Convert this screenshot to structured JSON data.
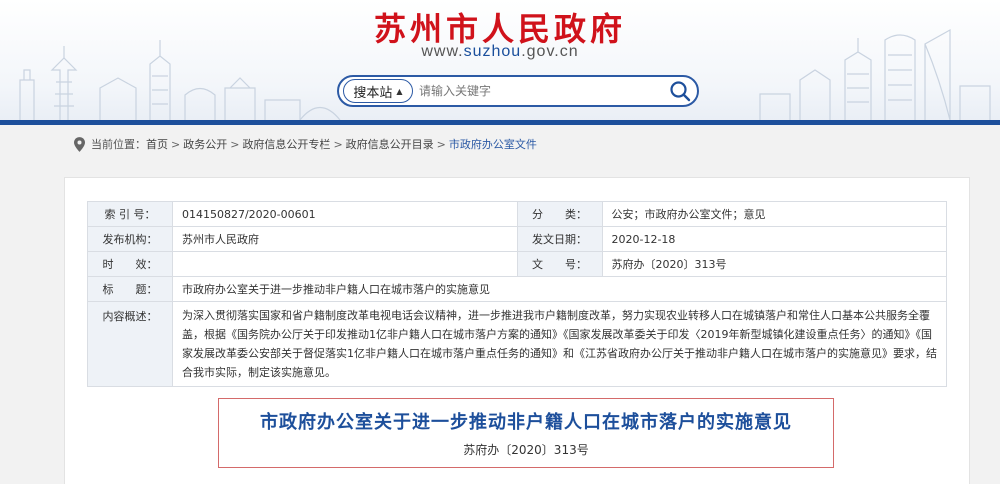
{
  "header": {
    "site_title": "苏州市人民政府",
    "site_url_prefix": "www.",
    "site_url_highlight": "suzhou",
    "site_url_suffix": ".gov.cn",
    "search_scope": "搜本站",
    "search_placeholder": "请输入关键字",
    "accent": "#d0121b",
    "brand": "#1d4f9b"
  },
  "breadcrumb": {
    "label": "当前位置：",
    "items": [
      "首页",
      "政务公开",
      "政府信息公开专栏",
      "政府信息公开目录",
      "市政府办公室文件"
    ],
    "separator": ">"
  },
  "meta": {
    "index_label": "索 引 号：",
    "index_value": "014150827/2020-00601",
    "category_label": "分　　类：",
    "category_value": "公安；市政府办公室文件；意见",
    "issuer_label": "发布机构：",
    "issuer_value": "苏州市人民政府",
    "date_label": "发文日期：",
    "date_value": "2020-12-18",
    "validity_label": "时　　效：",
    "validity_value": "",
    "docno_label": "文　　号：",
    "docno_value": "苏府办〔2020〕313号",
    "subject_label": "标　　题：",
    "subject_value": "市政府办公室关于进一步推动非户籍人口在城市落户的实施意见",
    "summary_label": "内容概述：",
    "summary_value": "为深入贯彻落实国家和省户籍制度改革电视电话会议精神，进一步推进我市户籍制度改革，努力实现农业转移人口在城镇落户和常住人口基本公共服务全覆盖，根据《国务院办公厅关于印发推动1亿非户籍人口在城市落户方案的通知》《国家发展改革委关于印发〈2019年新型城镇化建设重点任务〉的通知》《国家发展改革委公安部关于督促落实1亿非户籍人口在城市落户重点任务的通知》和《江苏省政府办公厅关于推动非户籍人口在城市落户的实施意见》要求，结合我市实际，制定该实施意见。"
  },
  "document": {
    "title": "市政府办公室关于进一步推动非户籍人口在城市落户的实施意见",
    "number": "苏府办〔2020〕313号"
  }
}
